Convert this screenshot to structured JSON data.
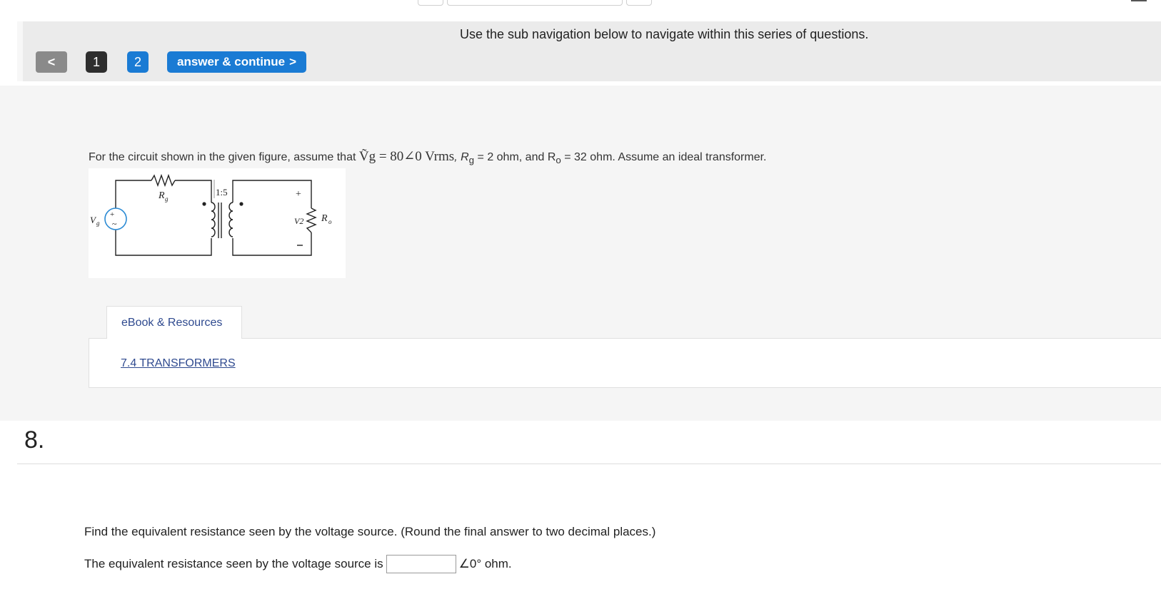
{
  "subnav": {
    "hint": "Use the sub navigation below to navigate within this series of questions.",
    "prev_label": "<",
    "questions": [
      "1",
      "2"
    ],
    "answer_continue": "answer & continue",
    "continue_chevron": ">"
  },
  "question": {
    "stem_before": "For the circuit shown in the given figure, assume that ",
    "stem_math": "Ṽg = 80∠0 Vrms",
    "stem_rg_pre": ", R",
    "stem_rg_sub": "g",
    "stem_rg_post": " = 2 ohm, and R",
    "stem_ro_sub": "o",
    "stem_end": " = 32 ohm. Assume an ideal transformer.",
    "figure": {
      "rg_label": "R",
      "rg_sub": "g",
      "ratio_label": "1:5",
      "vg_label": "V",
      "vg_sub": "g",
      "v2_label": "V2",
      "plus": "+",
      "minus": "−",
      "ro_label": "R",
      "ro_sub": "o"
    }
  },
  "resources": {
    "tab_label": "eBook & Resources",
    "link_text": "7.4 TRANSFORMERS"
  },
  "part": {
    "number": "8.",
    "prompt": "Find the equivalent resistance seen by the voltage source. (Round the final answer to two decimal places.)",
    "answer_prefix": "The equivalent resistance seen by the voltage source is",
    "answer_value": "",
    "answer_suffix": "∠0° ohm."
  },
  "colors": {
    "accent_blue": "#1a7bd4",
    "link_blue": "#2f4a8f",
    "dark_chip": "#2e2e2e",
    "prev_grey": "#8a8a8a"
  }
}
